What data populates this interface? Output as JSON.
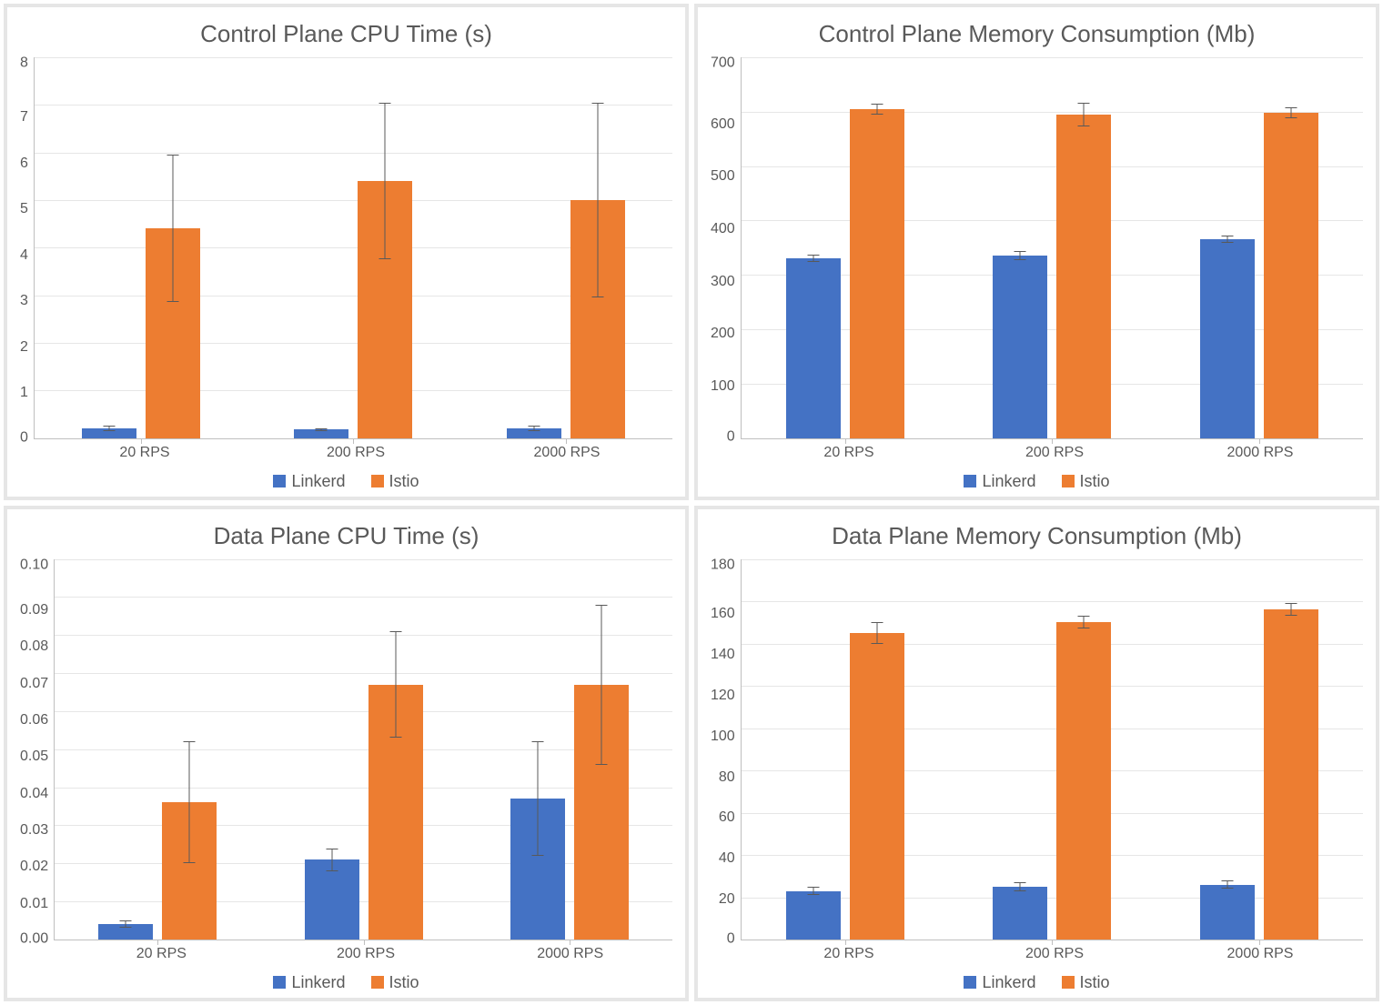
{
  "legend": {
    "linkerd": "Linkerd",
    "istio": "Istio"
  },
  "chart_data": [
    {
      "id": "cp-cpu",
      "type": "bar",
      "title": "Control Plane CPU Time (s)",
      "categories": [
        "20 RPS",
        "200 RPS",
        "2000 RPS"
      ],
      "ylim": [
        0,
        8
      ],
      "ystep": 1,
      "series": [
        {
          "name": "Linkerd",
          "values": [
            0.2,
            0.18,
            0.2
          ],
          "err": [
            0.05,
            0.03,
            0.06
          ]
        },
        {
          "name": "Istio",
          "values": [
            4.4,
            5.4,
            5.0
          ],
          "err": [
            1.55,
            1.65,
            2.05
          ]
        }
      ]
    },
    {
      "id": "cp-mem",
      "type": "bar",
      "title": "Control Plane Memory Consumption (Mb)",
      "categories": [
        "20 RPS",
        "200 RPS",
        "2000 RPS"
      ],
      "ylim": [
        0,
        700
      ],
      "ystep": 100,
      "series": [
        {
          "name": "Linkerd",
          "values": [
            330,
            335,
            365
          ],
          "err": [
            7,
            8,
            7
          ]
        },
        {
          "name": "Istio",
          "values": [
            605,
            595,
            598
          ],
          "err": [
            10,
            22,
            10
          ]
        }
      ]
    },
    {
      "id": "dp-cpu",
      "type": "bar",
      "title": "Data Plane CPU Time (s)",
      "categories": [
        "20 RPS",
        "200 RPS",
        "2000 RPS"
      ],
      "ylim": [
        0,
        0.1
      ],
      "ystep": 0.01,
      "series": [
        {
          "name": "Linkerd",
          "values": [
            0.004,
            0.021,
            0.037
          ],
          "err": [
            0.001,
            0.003,
            0.015
          ]
        },
        {
          "name": "Istio",
          "values": [
            0.036,
            0.067,
            0.067
          ],
          "err": [
            0.016,
            0.014,
            0.021
          ]
        }
      ]
    },
    {
      "id": "dp-mem",
      "type": "bar",
      "title": "Data Plane Memory Consumption (Mb)",
      "categories": [
        "20 RPS",
        "200 RPS",
        "2000 RPS"
      ],
      "ylim": [
        0,
        180
      ],
      "ystep": 20,
      "series": [
        {
          "name": "Linkerd",
          "values": [
            23,
            25,
            26
          ],
          "err": [
            2,
            2,
            2
          ]
        },
        {
          "name": "Istio",
          "values": [
            145,
            150,
            156
          ],
          "err": [
            5,
            3,
            3
          ]
        }
      ]
    }
  ]
}
